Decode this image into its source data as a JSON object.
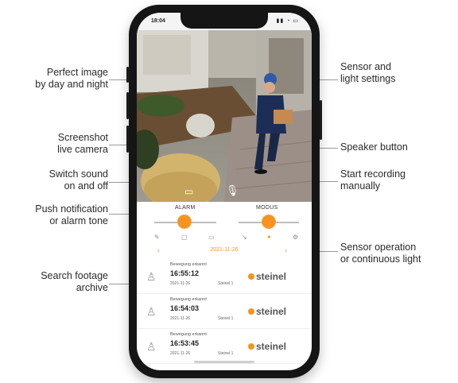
{
  "callouts": {
    "perfect_image": "Perfect image\nby day and night",
    "screenshot": "Screenshot\nlive camera",
    "switch_sound": "Switch sound\non and off",
    "push_notification": "Push notification\nor alarm tone",
    "search_footage": "Search footage\narchive",
    "sensor_light": "Sensor and\nlight settings",
    "speaker": "Speaker button",
    "start_recording": "Start recording\nmanually",
    "sensor_operation": "Sensor operation\nor continuous light"
  },
  "status_bar": {
    "time": "18:04"
  },
  "controls": {
    "alarm_label": "ALARM",
    "modus_label": "MODUS"
  },
  "archive": {
    "date": "2021-11-26",
    "entries": [
      {
        "status": "Bewegung erkannt",
        "time": "16:55:12",
        "date": "2021-11-26",
        "device": "Steinel 1",
        "brand": "steinel"
      },
      {
        "status": "Bewegung erkannt",
        "time": "16:54:03",
        "date": "2021-11-26",
        "device": "Steinel 1",
        "brand": "steinel"
      },
      {
        "status": "Bewegung erkannt",
        "time": "16:53:45",
        "date": "2021-11-26",
        "device": "Steinel 1",
        "brand": "steinel"
      }
    ]
  },
  "colors": {
    "accent": "#f7931e"
  },
  "icons": [
    "signal-icon",
    "wifi-icon",
    "battery-icon",
    "microphone-icon",
    "camera-snapshot-icon",
    "speaker-icon",
    "video-icon",
    "gear-icon",
    "person-icon"
  ]
}
